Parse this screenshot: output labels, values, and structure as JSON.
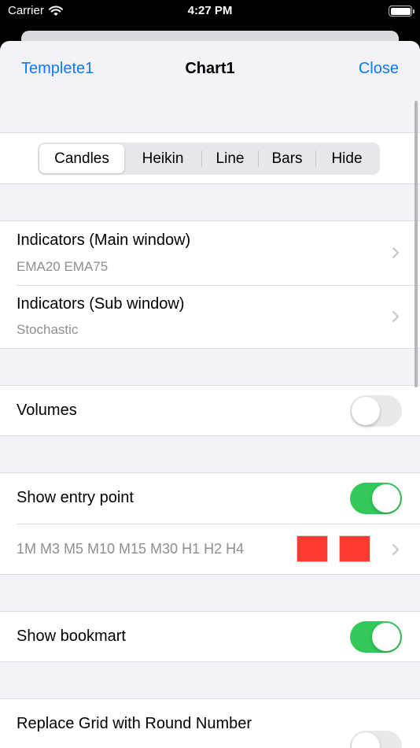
{
  "status_bar": {
    "carrier": "Carrier",
    "time": "4:27 PM",
    "icons": [
      "wifi-icon",
      "battery-icon"
    ]
  },
  "nav": {
    "left_label": "Templete1",
    "title": "Chart1",
    "right_label": "Close"
  },
  "chart_type": {
    "options": [
      "Candles",
      "Heikin",
      "Line",
      "Bars",
      "Hide"
    ],
    "selected": "Candles"
  },
  "indicators": {
    "main": {
      "title": "Indicators (Main window)",
      "value": "EMA20 EMA75"
    },
    "sub": {
      "title": "Indicators (Sub window)",
      "value": "Stochastic"
    }
  },
  "volumes": {
    "label": "Volumes",
    "enabled": false
  },
  "entry_point": {
    "label": "Show entry point",
    "enabled": true,
    "timeframes": "1M M3 M5 M10 M15 M30 H1 H2 H4",
    "colors": [
      "#ff3b30",
      "#ff3b30"
    ]
  },
  "bookmark": {
    "label": "Show bookmart",
    "enabled": true
  },
  "grid": {
    "label": "Replace Grid with Round Number",
    "enabled": false
  },
  "colors": {
    "accent": "#0a7aff",
    "toggle_on": "#34c759",
    "toggle_off": "#e9e9eb",
    "background": "#f2f2f7",
    "secondary_text": "#8e8e93"
  }
}
